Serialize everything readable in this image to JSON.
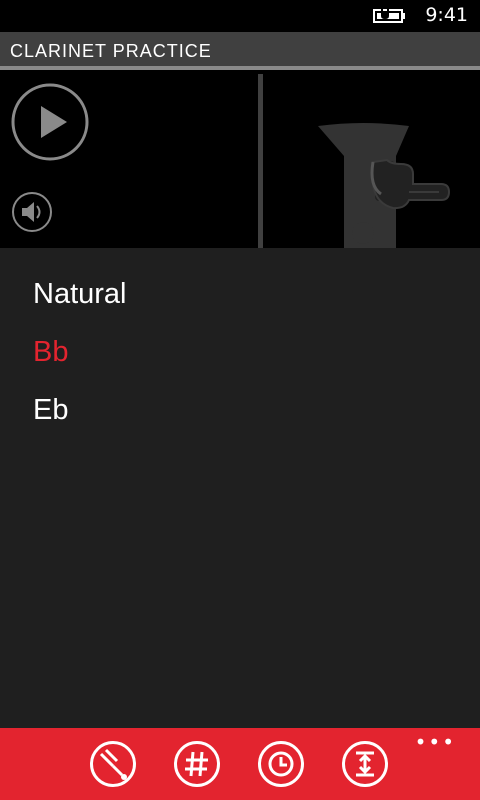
{
  "status": {
    "time": "9:41",
    "battery_icon": "battery-charging-icon"
  },
  "header": {
    "title": "CLARINET  PRACTICE"
  },
  "player": {
    "play_icon": "play-icon",
    "volume_icon": "speaker-icon",
    "image_icon": "clarinet-fingering-icon"
  },
  "list": {
    "items": [
      {
        "label": "Natural",
        "selected": false
      },
      {
        "label": "Bb",
        "selected": true
      },
      {
        "label": "Eb",
        "selected": false
      }
    ]
  },
  "appbar": {
    "buttons": [
      "tuning-fork-icon",
      "sharp-icon",
      "clock-icon",
      "range-icon"
    ],
    "more_label": "•••"
  },
  "colors": {
    "accent": "#e3242f",
    "background": "#1f1f1f",
    "titlebar": "#404040"
  }
}
